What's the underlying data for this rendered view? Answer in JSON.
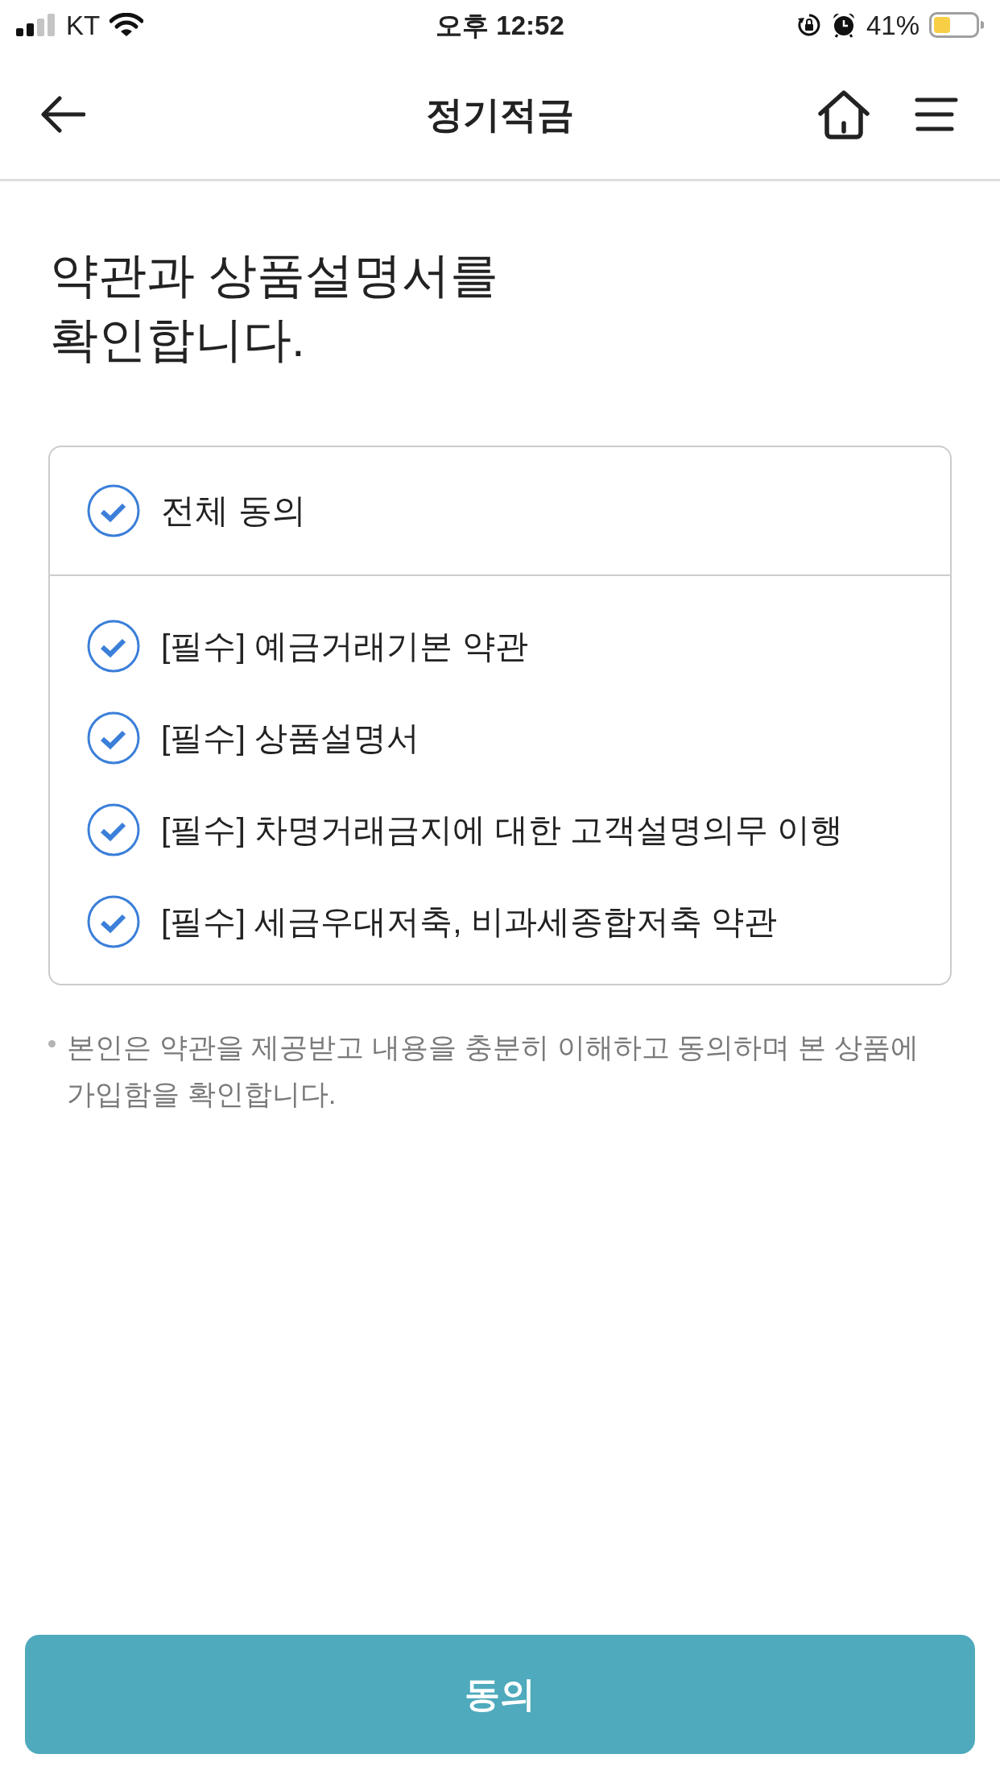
{
  "status_bar": {
    "carrier": "KT",
    "time": "오후 12:52",
    "battery": "41%"
  },
  "header": {
    "title": "정기적금"
  },
  "heading": "약관과 상품설명서를\n확인합니다.",
  "agreements": {
    "all": {
      "label": "전체 동의",
      "checked": true
    },
    "items": [
      {
        "label": "[필수] 예금거래기본 약관",
        "checked": true
      },
      {
        "label": "[필수] 상품설명서",
        "checked": true
      },
      {
        "label": "[필수] 차명거래금지에 대한 고객설명의무 이행",
        "checked": true
      },
      {
        "label": "[필수] 세금우대저축, 비과세종합저축 약관",
        "checked": true
      }
    ]
  },
  "note": "본인은 약관을 제공받고 내용을 충분히 이해하고 동의하며 본 상품에 가입함을 확인합니다.",
  "button": {
    "label": "동의"
  }
}
